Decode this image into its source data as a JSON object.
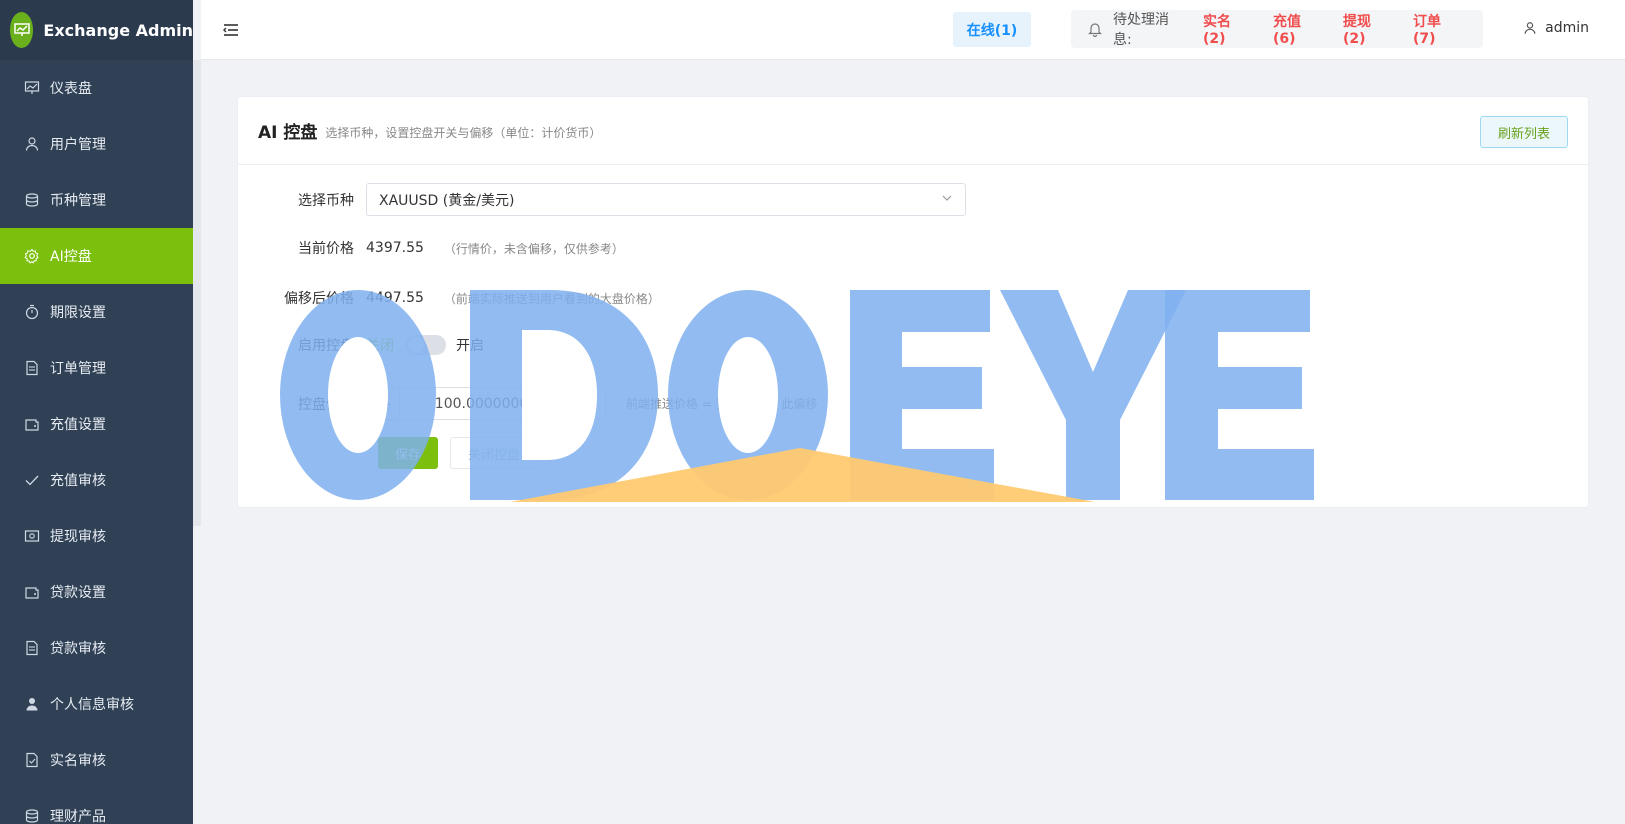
{
  "brand": {
    "title": "Exchange Admin"
  },
  "sidebar": {
    "items": [
      {
        "label": "仪表盘",
        "icon": "dashboard-icon",
        "active": false
      },
      {
        "label": "用户管理",
        "icon": "user-icon",
        "active": false
      },
      {
        "label": "币种管理",
        "icon": "coins-icon",
        "active": false
      },
      {
        "label": "AI控盘",
        "icon": "gear-icon",
        "active": true
      },
      {
        "label": "期限设置",
        "icon": "stopwatch-icon",
        "active": false
      },
      {
        "label": "订单管理",
        "icon": "document-icon",
        "active": false
      },
      {
        "label": "充值设置",
        "icon": "wallet-icon",
        "active": false
      },
      {
        "label": "充值审核",
        "icon": "check-icon",
        "active": false
      },
      {
        "label": "提现审核",
        "icon": "money-icon",
        "active": false
      },
      {
        "label": "贷款设置",
        "icon": "wallet-icon",
        "active": false
      },
      {
        "label": "贷款审核",
        "icon": "document-icon",
        "active": false
      },
      {
        "label": "个人信息审核",
        "icon": "person-icon",
        "active": false
      },
      {
        "label": "实名审核",
        "icon": "doc-check-icon",
        "active": false
      },
      {
        "label": "理财产品",
        "icon": "coins-icon",
        "active": false
      }
    ]
  },
  "header": {
    "online": "在线(1)",
    "pending_label": "待处理消息:",
    "tags": [
      "实名(2)",
      "充值(6)",
      "提现(2)",
      "订单(7)"
    ],
    "user": "admin"
  },
  "card": {
    "title": "AI 控盘",
    "subtitle": "选择币种，设置控盘开关与偏移（单位：计价货币）",
    "refresh_label": "刷新列表"
  },
  "form": {
    "symbol_label": "选择币种",
    "symbol_value": "XAUUSD (黄金/美元)",
    "current_price_label": "当前价格",
    "current_price": "4397.55",
    "current_price_note": "（行情价，未含偏移，仅供参考）",
    "offset_price_label": "偏移后价格",
    "offset_price": "4497.55",
    "offset_price_note": "（前端实际推送到用户看到的大盘价格）",
    "enable_label": "启用控盘",
    "switch_off": "关闭",
    "switch_on": "开启",
    "switch_state": false,
    "offset_label": "控盘偏移",
    "offset_value": "100.00000000",
    "offset_note": "前端推送价格 = 实际价格 + 此偏移",
    "save_label": "保存",
    "close_label": "关闭控盘"
  },
  "colors": {
    "accent": "#7cbf0c",
    "sidebar": "#304156",
    "tag": "#f04d4d",
    "online": "#1890ff"
  }
}
